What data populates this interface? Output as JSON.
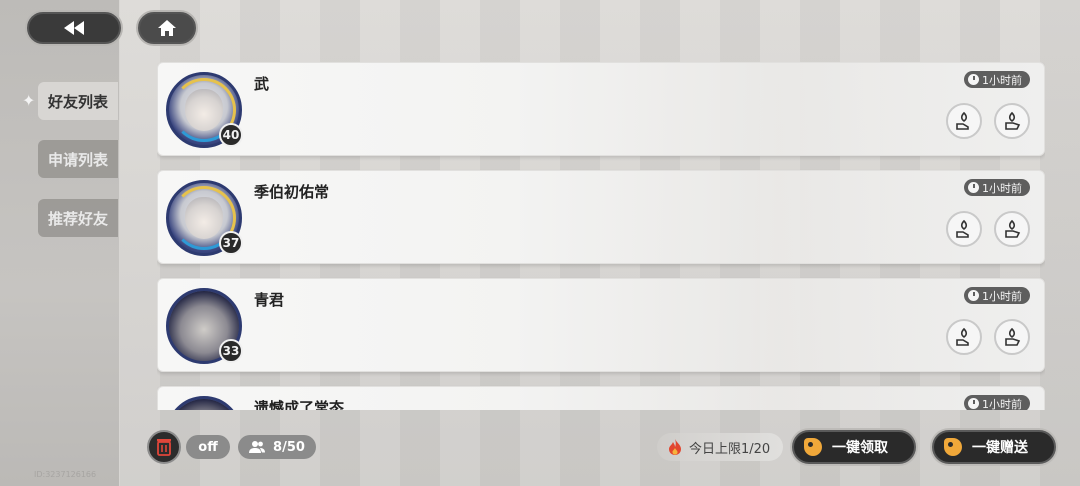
{
  "nav": {
    "back_icon": "rewind-icon",
    "home_icon": "home-icon"
  },
  "sidebar": {
    "items": [
      {
        "label": "好友列表",
        "active": true
      },
      {
        "label": "申请列表",
        "active": false
      },
      {
        "label": "推荐好友",
        "active": false
      }
    ]
  },
  "friends": [
    {
      "name": "武",
      "level": "40",
      "time": "1小时前"
    },
    {
      "name": "季伯初佑常",
      "level": "37",
      "time": "1小时前"
    },
    {
      "name": "青君",
      "level": "33",
      "time": "1小时前"
    },
    {
      "name": "遗憾成了常态",
      "level": "",
      "time": "1小时前"
    }
  ],
  "bottom": {
    "toggle_label": "off",
    "friend_count": "8/50",
    "daily_limit": "今日上限1/20",
    "claim_all": "一键领取",
    "send_all": "一键赠送"
  },
  "uid_text": "ID:3237126166",
  "colors": {
    "accent_orange": "#f0a83a",
    "button_dark": "#2a2a2a",
    "card_bg": "#f5f5f4"
  }
}
